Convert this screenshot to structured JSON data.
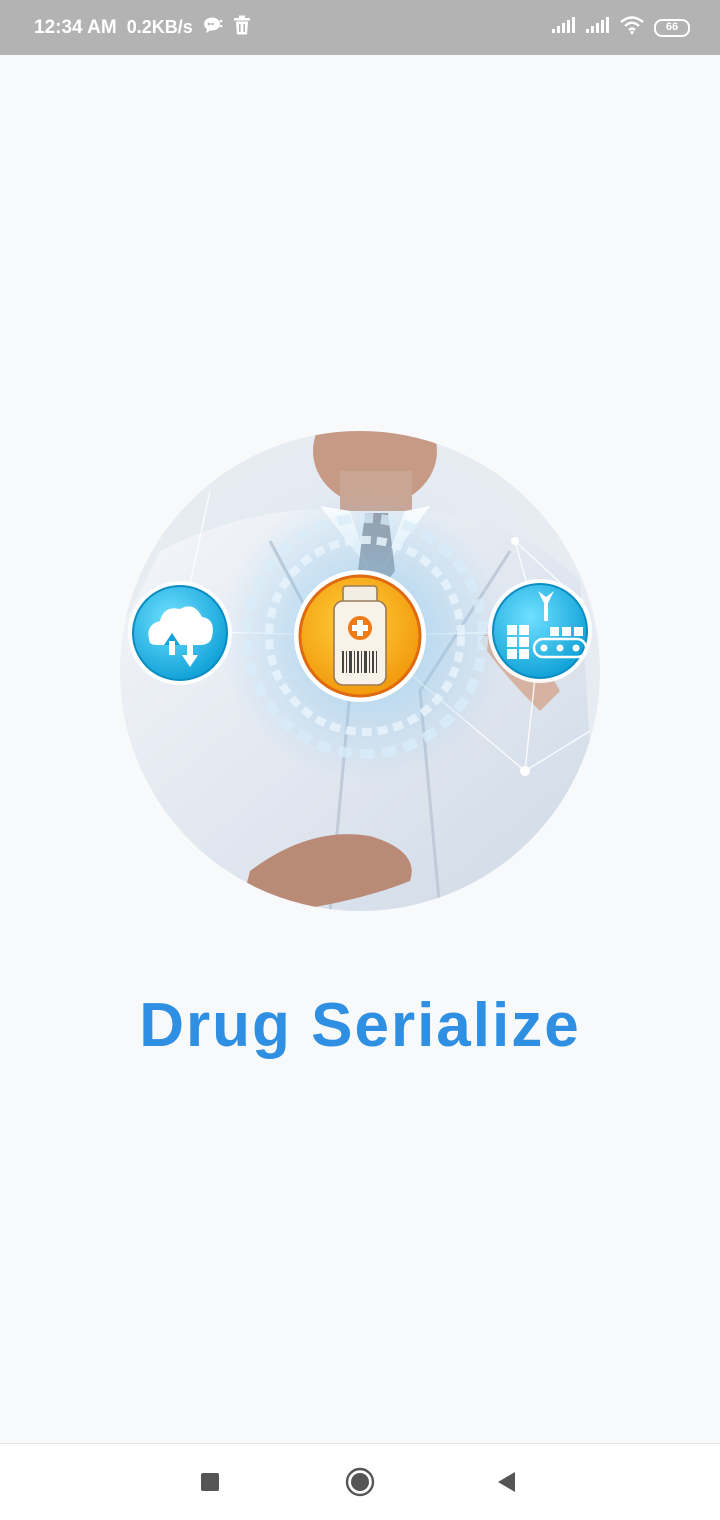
{
  "status_bar": {
    "time": "12:34 AM",
    "speed": "0.2KB/s",
    "battery": "66",
    "icons": [
      "chat-bubble-icon",
      "trash-icon",
      "signal-icon",
      "signal-icon",
      "wifi-icon",
      "battery-icon"
    ]
  },
  "app": {
    "title": "Drug Serialize",
    "title_color": "#2e8fe3",
    "splash_icons": [
      "cloud-sync-icon",
      "medicine-bottle-icon",
      "factory-conveyor-icon"
    ]
  },
  "nav": {
    "icons": [
      "recent-apps-icon",
      "home-icon",
      "back-icon"
    ]
  }
}
